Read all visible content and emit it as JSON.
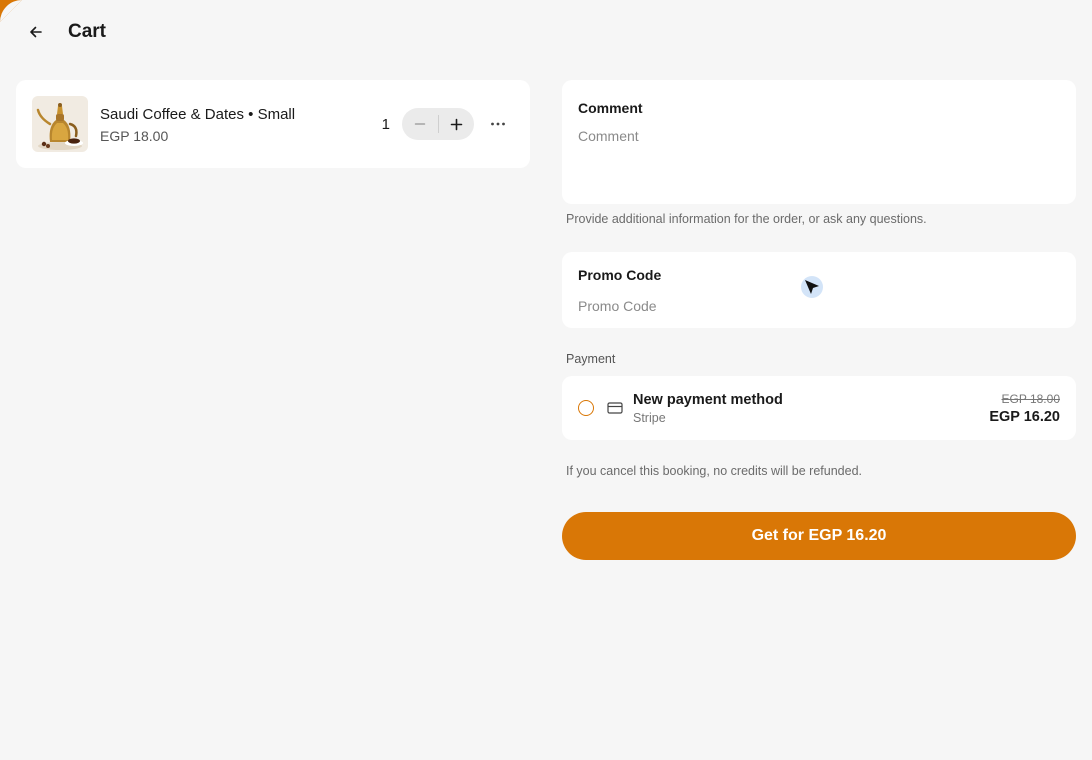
{
  "colors": {
    "accent": "#d97706",
    "background": "#f6f6f6",
    "card": "#ffffff"
  },
  "header": {
    "title": "Cart",
    "back_icon": "arrow-left-icon"
  },
  "cart": {
    "items": [
      {
        "name": "Saudi Coffee & Dates • Small",
        "price": "EGP 18.00",
        "quantity": "1",
        "image": "coffee-pot-image"
      }
    ],
    "decrement_icon": "minus-icon",
    "increment_icon": "plus-icon",
    "more_icon": "ellipsis-icon"
  },
  "comment": {
    "label": "Comment",
    "placeholder": "Comment",
    "value": "",
    "helper": "Provide additional information for the order, or ask any questions."
  },
  "promo": {
    "label": "Promo Code",
    "placeholder": "Promo Code",
    "value": ""
  },
  "payment": {
    "section_label": "Payment",
    "method_name": "New payment method",
    "provider": "Stripe",
    "original_price": "EGP 18.00",
    "final_price": "EGP 16.20",
    "selected": false,
    "icon": "credit-card-icon"
  },
  "notice": "If you cancel this booking, no credits will be refunded.",
  "checkout": {
    "button_label": "Get for EGP 16.20"
  }
}
